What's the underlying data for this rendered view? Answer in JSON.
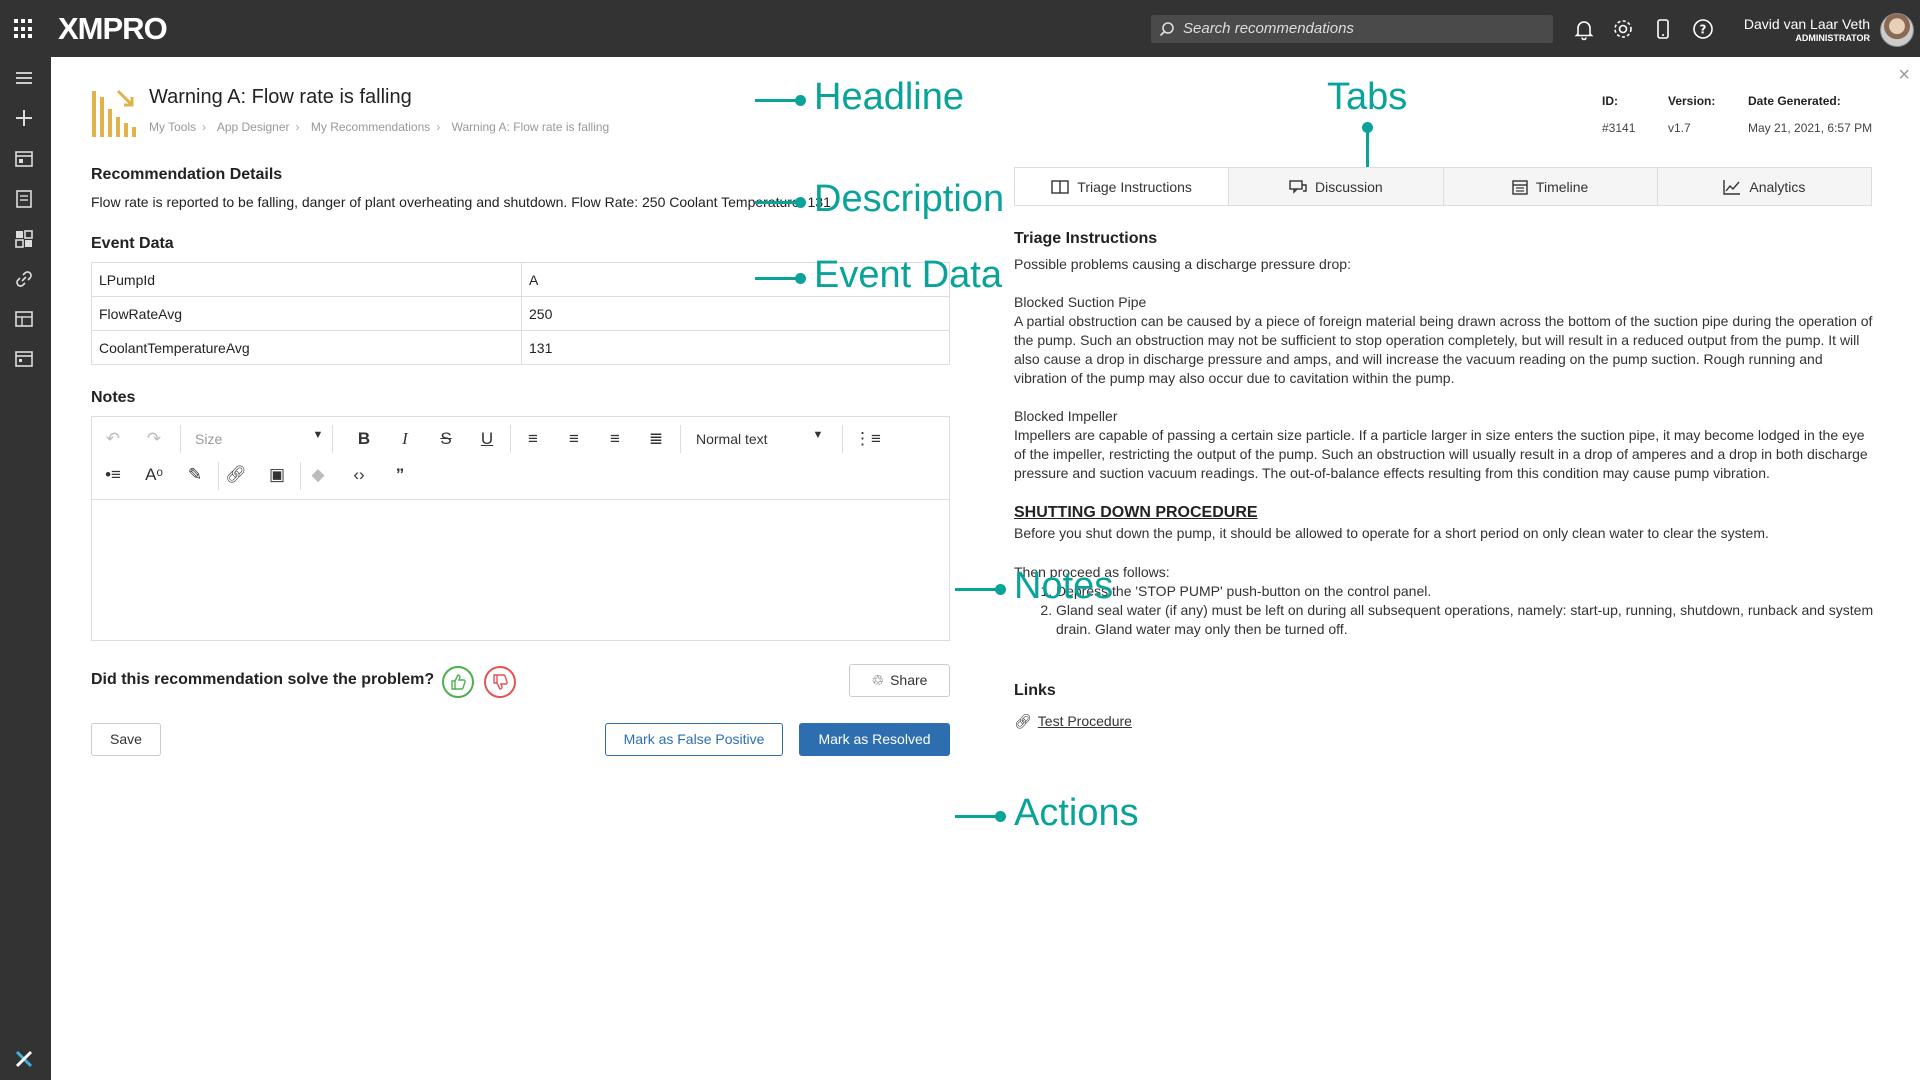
{
  "topbar": {
    "logo": "XMPRO",
    "search_placeholder": "Search recommendations",
    "user_name": "David van Laar Veth",
    "user_role": "ADMINISTRATOR"
  },
  "header": {
    "title": "Warning A: Flow rate is falling",
    "breadcrumbs": [
      "My Tools",
      "App Designer",
      "My Recommendations",
      "Warning A: Flow rate is falling"
    ],
    "id_label": "ID:",
    "id_value": "#3141",
    "version_label": "Version:",
    "version_value": "v1.7",
    "date_label": "Date Generated:",
    "date_value": "May 21, 2021, 6:57 PM"
  },
  "details": {
    "title": "Recommendation Details",
    "description": "Flow rate is reported to be falling, danger of plant overheating and shutdown. Flow Rate: 250 Coolant Temperature: 131"
  },
  "event_data": {
    "title": "Event Data",
    "rows": [
      {
        "key": "LPumpId",
        "value": "A"
      },
      {
        "key": "FlowRateAvg",
        "value": "250"
      },
      {
        "key": "CoolantTemperatureAvg",
        "value": "131"
      }
    ]
  },
  "notes": {
    "title": "Notes",
    "size_label": "Size",
    "format_label": "Normal text"
  },
  "feedback": {
    "question": "Did this recommendation solve the problem?",
    "share_label": "Share",
    "thumb_up_color": "#4caf50",
    "thumb_down_color": "#e05555"
  },
  "actions": {
    "save_label": "Save",
    "false_positive_label": "Mark as False Positive",
    "resolved_label": "Mark as Resolved"
  },
  "tabs": [
    {
      "label": "Triage Instructions",
      "icon": "book-icon"
    },
    {
      "label": "Discussion",
      "icon": "chat-icon"
    },
    {
      "label": "Timeline",
      "icon": "calendar-icon"
    },
    {
      "label": "Analytics",
      "icon": "chart-icon"
    }
  ],
  "triage": {
    "title": "Triage Instructions",
    "intro": "Possible problems causing a discharge pressure drop:",
    "section1_title": "Blocked Suction Pipe",
    "section1_body": "A partial obstruction can be caused by a piece of foreign material being drawn across the bottom of the suction pipe during the operation of the pump. Such an obstruction may not be sufficient to stop operation completely, but will result in a reduced output from the pump. It will also cause a drop in discharge pressure and amps, and will increase the vacuum reading on the pump suction. Rough running and vibration of the pump may also occur due to cavitation within the pump.",
    "section2_title": "Blocked Impeller",
    "section2_body": "Impellers are capable of passing a certain size particle. If a particle larger in size enters the suction pipe, it may become lodged in the eye of the impeller, restricting the output of the pump. Such an obstruction will usually result in a drop of amperes and a drop in both discharge pressure and suction vacuum readings. The out-of-balance effects resulting from this condition may cause pump vibration.",
    "procedure_title": "SHUTTING DOWN PROCEDURE",
    "procedure_intro": "Before you shut down the pump, it should be allowed to operate for a short period on only clean water to clear the system.",
    "procedure_then": "Then proceed as follows:",
    "steps": [
      "Depress the 'STOP PUMP' push-button on the control panel.",
      "Gland seal water (if any) must be left on during all subsequent operations, namely: start-up, running, shutdown, runback and system drain. Gland water may only then be turned off."
    ]
  },
  "links": {
    "title": "Links",
    "items": [
      {
        "label": "Test Procedure"
      }
    ]
  },
  "annotations": {
    "headline": "Headline",
    "tabs": "Tabs",
    "description": "Description",
    "event_data": "Event Data",
    "notes": "Notes",
    "actions": "Actions",
    "color": "#0aa39a"
  }
}
